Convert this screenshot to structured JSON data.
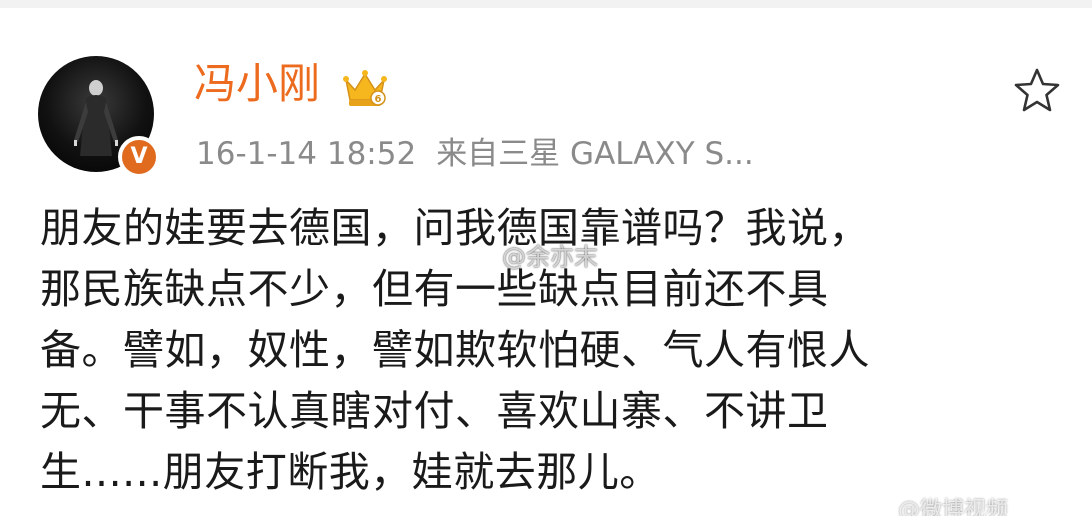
{
  "post": {
    "author": "冯小刚",
    "timestamp": "16-1-14 18:52",
    "source": "来自三星 GALAXY S...",
    "badge_letter": "V",
    "lines": [
      "朋友的娃要去德国，问我德国靠谱吗？我说，",
      "那民族缺点不少，但有一些缺点目前还不具",
      "备。譬如，奴性，譬如欺软怕硬、气人有恨人",
      "无、干事不认真瞎对付、喜欢山寨、不讲卫",
      "生......朋友打断我，娃就去那儿。"
    ]
  },
  "watermarks": {
    "center": "@余亦末",
    "corner": "@微博视频"
  },
  "icons": {
    "crown": "crown-icon",
    "star": "star-icon",
    "weibo": "weibo-logo-icon"
  },
  "colors": {
    "name": "#ec6b1e",
    "badge": "#e06b1f",
    "meta": "#8a8a8a",
    "text": "#1a1a1a"
  }
}
